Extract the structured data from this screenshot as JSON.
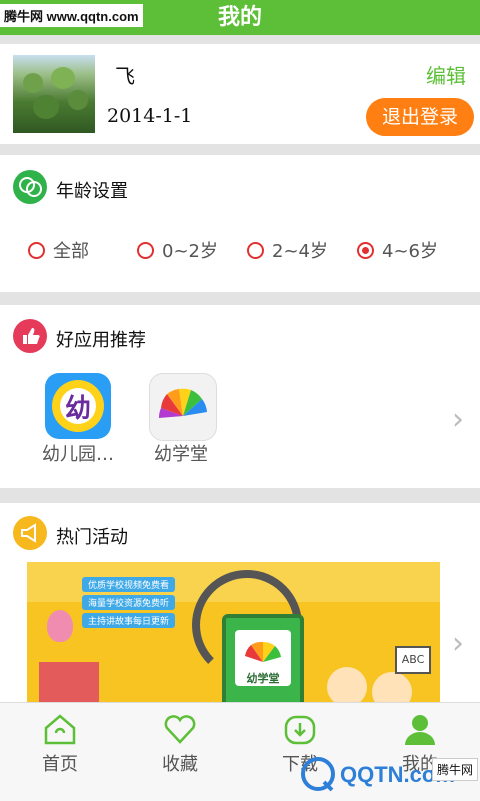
{
  "header": {
    "title": "我的",
    "watermark": "腾牛网 www.qqtn.com"
  },
  "profile": {
    "name": "飞",
    "date": "2014-1-1",
    "edit_label": "编辑",
    "logout_label": "退出登录"
  },
  "age_settings": {
    "title": "年龄设置",
    "options": [
      {
        "label": "全部",
        "selected": false
      },
      {
        "label": "0~2岁",
        "selected": false
      },
      {
        "label": "2~4岁",
        "selected": false
      },
      {
        "label": "4~6岁",
        "selected": true
      }
    ]
  },
  "recommend": {
    "title": "好应用推荐",
    "apps": [
      {
        "label": "幼儿园…",
        "icon_text": "幼"
      },
      {
        "label": "幼学堂"
      }
    ]
  },
  "events": {
    "title": "热门活动",
    "banner": {
      "lines": [
        "优质学校视频免费看",
        "海量学校资源免费听",
        "主持讲故事每日更新"
      ],
      "logo_text": "幼学堂",
      "badge_text": "ABC"
    }
  },
  "tabbar": {
    "items": [
      {
        "label": "首页",
        "active": false
      },
      {
        "label": "收藏",
        "active": false
      },
      {
        "label": "下载",
        "active": false
      },
      {
        "label": "我的",
        "active": true
      }
    ]
  },
  "footer_watermark": {
    "brand": "QQTN.com",
    "badge": "腾牛网"
  },
  "colors": {
    "accent": "#5cbf37",
    "orange": "#ff7f12",
    "radio": "#e03030"
  }
}
